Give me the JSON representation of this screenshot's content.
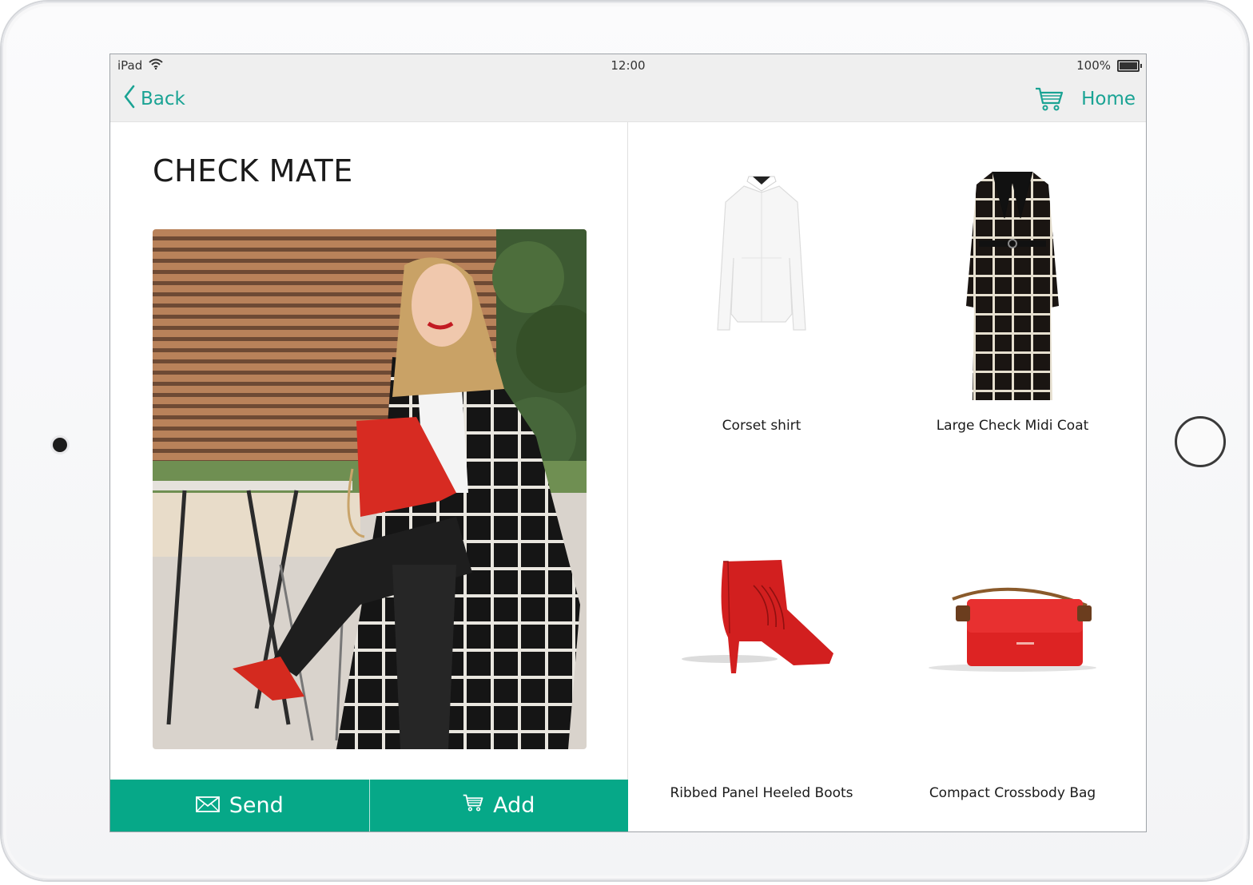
{
  "status_bar": {
    "device": "iPad",
    "time": "12:00",
    "battery": "100%"
  },
  "nav": {
    "back_label": "Back",
    "home_label": "Home"
  },
  "look": {
    "title": "CHECK MATE"
  },
  "actions": {
    "send_label": "Send",
    "add_label": "Add"
  },
  "products": [
    {
      "name": "Corset shirt"
    },
    {
      "name": "Large Check Midi Coat"
    },
    {
      "name": "Ribbed Panel Heeled Boots"
    },
    {
      "name": "Compact Crossbody Bag"
    }
  ],
  "colors": {
    "accent": "#1aa394",
    "button_bg": "#06a888",
    "bar_bg": "#efefef"
  },
  "icons": [
    "wifi-icon",
    "battery-icon",
    "chevron-left-icon",
    "cart-icon",
    "envelope-icon"
  ]
}
